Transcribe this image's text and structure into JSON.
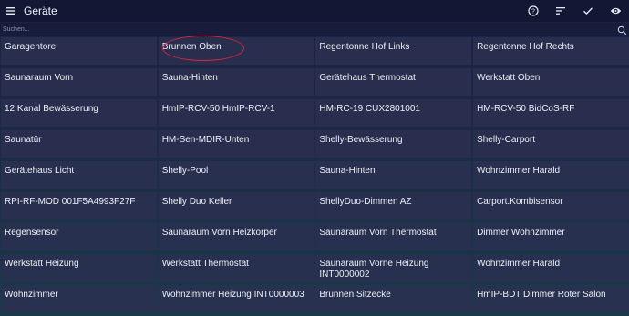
{
  "app": {
    "title": "Geräte"
  },
  "search": {
    "placeholder": "Suchen..."
  },
  "devices": [
    "Garagentore",
    "Brunnen Oben",
    "Regentonne Hof Links",
    "Regentonne Hof Rechts",
    "Saunaraum Vorn",
    "Sauna-Hinten",
    "Gerätehaus Thermostat",
    "Werkstatt Oben",
    "12 Kanal Bewässerung",
    "HmIP-RCV-50 HmIP-RCV-1",
    "HM-RC-19 CUX2801001",
    "HM-RCV-50 BidCoS-RF",
    "Saunatür",
    "HM-Sen-MDIR-Unten",
    "Shelly-Bewässerung",
    "Shelly-Carport",
    "Gerätehaus Licht",
    "Shelly-Pool",
    "Sauna-Hinten",
    "Wohnzimmer Harald",
    "RPI-RF-MOD 001F5A4993F27F",
    "Shelly Duo Keller",
    "ShellyDuo-Dimmen AZ",
    "Carport.Kombisensor",
    "Regensensor",
    "Saunaraum Vorn Heizkörper",
    "Saunaraum Vorn Thermostat",
    "Dimmer Wohnzimmer",
    "Werkstatt Heizung",
    "Werkstatt Thermostat",
    "Saunaraum Vorne Heizung\nINT0000002",
    "Wohnzimmer Harald",
    "Wohnzimmer",
    "Wohnzimmer Heizung INT0000003",
    "Brunnen Sitzecke",
    "HmIP-BDT Dimmer Roter Salon"
  ],
  "colors": {
    "highlight_circle": "#d4283a",
    "appbar": "#121733"
  }
}
